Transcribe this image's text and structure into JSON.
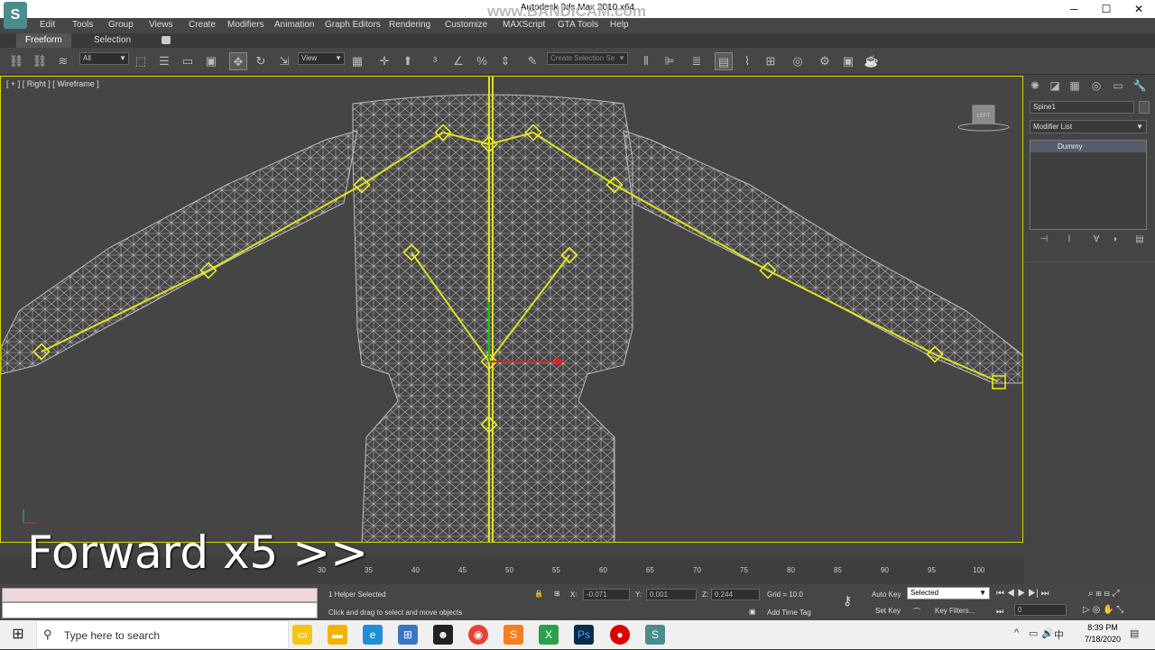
{
  "window": {
    "title": "Autodesk 3ds Max  2010 x64",
    "watermark": "www.BANDICAM.com",
    "minimize": "─",
    "maximize": "☐",
    "close": "✕",
    "app_logo": "S"
  },
  "menu": [
    "Edit",
    "Tools",
    "Group",
    "Views",
    "Create",
    "Modifiers",
    "Animation",
    "Graph Editors",
    "Rendering",
    "Customize",
    "MAXScript",
    "GTA Tools",
    "Help"
  ],
  "ribbon": {
    "tabs": [
      "Freeform",
      "Selection"
    ]
  },
  "toolbar": {
    "filter_select": "All",
    "refcoord_select": "View",
    "named_selection": "Create Selection Se"
  },
  "viewport": {
    "label": "[ + ] [ Right ] [ Wireframe ]",
    "viewcube_label": "LEFT"
  },
  "command_panel": {
    "object_name": "Spine1",
    "modifier_list": "Modifier List",
    "stack_entry": "Dummy"
  },
  "trackbar": {
    "ticks": [
      "30",
      "35",
      "40",
      "45",
      "50",
      "55",
      "60",
      "65",
      "70",
      "75",
      "80",
      "85",
      "90",
      "95",
      "100"
    ]
  },
  "overlay": {
    "text": "Forward x5 >>"
  },
  "status": {
    "selection_info": "1 Helper Selected",
    "prompt": "Click and drag to select and move objects",
    "x_label": "X:",
    "x_value": "-0.071",
    "y_label": "Y:",
    "y_value": "0.001",
    "z_label": "Z:",
    "z_value": "0.244",
    "grid": "Grid = 10.0",
    "add_time_tag": "Add Time Tag",
    "auto_key": "Auto Key",
    "set_key": "Set Key",
    "key_mode": "Selected",
    "key_filters": "Key Filters...",
    "frame": "0"
  },
  "taskbar": {
    "search_placeholder": "Type here to search",
    "time": "8:39 PM",
    "date": "7/18/2020"
  }
}
